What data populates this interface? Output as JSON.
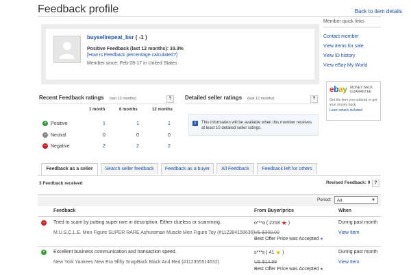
{
  "header": {
    "title": "Feedback profile",
    "back_link": "Back to item details"
  },
  "profile": {
    "username": "buysellrepeat_bsr",
    "score": "( -1 )",
    "positive_feedback": "Positive Feedback (last 12 months): 33.3%",
    "how_calculated": "[How is Feedback percentage calculated?]",
    "member_since": "Member since: Feb-28-17 in United States"
  },
  "sidebar": {
    "title": "Member quick links",
    "items": [
      {
        "label": "Contact member"
      },
      {
        "label": "View items for sale"
      },
      {
        "label": "View ID history"
      },
      {
        "label": "View eBay My World"
      }
    ]
  },
  "ebay_ad": {
    "logo": "ebay",
    "badge_line1": "MONEY BACK",
    "badge_line2": "GUARANTEE",
    "text": "Get the item you ordered or get your money back.",
    "learn": "Learn what's included"
  },
  "recent_ratings": {
    "title": "Recent Feedback ratings",
    "subtitle": "(last 12 months)",
    "help": "?",
    "columns": [
      "1 month",
      "6 months",
      "12 months"
    ],
    "rows": [
      {
        "label": "Positive",
        "values": [
          "1",
          "1",
          "1"
        ],
        "color": "#3a9a3a"
      },
      {
        "label": "Neutral",
        "values": [
          "0",
          "0",
          "0"
        ],
        "color": "#888888"
      },
      {
        "label": "Negative",
        "values": [
          "2",
          "2",
          "2"
        ],
        "color": "#d32020"
      }
    ]
  },
  "detailed_ratings": {
    "title": "Detailed seller ratings",
    "subtitle": "(last 12 months)",
    "help": "?",
    "info_icon": "i",
    "info_text": "This information will be available when this member receives at least 10 detailed seller ratings."
  },
  "tabs": [
    {
      "label": "Feedback as a seller"
    },
    {
      "label": "Search seller feedback"
    },
    {
      "label": "Feedback as a buyer"
    },
    {
      "label": "All Feedback"
    },
    {
      "label": "Feedback left for others"
    }
  ],
  "feedback": {
    "count": "3 Feedback received",
    "revised": "Revised Feedback: 0",
    "help": "?",
    "period_label": "Period:",
    "period_value": "All",
    "columns": [
      "Feedback",
      "From Buyer/price",
      "When"
    ],
    "rows": [
      {
        "type": "negative",
        "comment": "Tried to scam by putting super rare in description. Either clueless or scamming.",
        "item": "M.U.S.C.L.E. Men Figure SUPER RARE Ashuraman Muscle Men Figure Toy (#112384158636)",
        "buyer": "o***o ( 2218",
        "buyer_end": ")",
        "price": "US $300.00",
        "price_note": "Best Offer Price was Accepted",
        "when": "During past month",
        "view": "View Item"
      },
      {
        "type": "positive",
        "comment": "Excellent business communication and transaction speed.",
        "item": "New York Yankees New Era 9fifty SnapBack Black And Red (#112355514632)",
        "buyer": "s***s ( 41",
        "buyer_end": ")",
        "price": "US $14.99",
        "price_note": "Best Offer Price was Accepted",
        "when": "During past month",
        "view": "View Item"
      }
    ]
  }
}
